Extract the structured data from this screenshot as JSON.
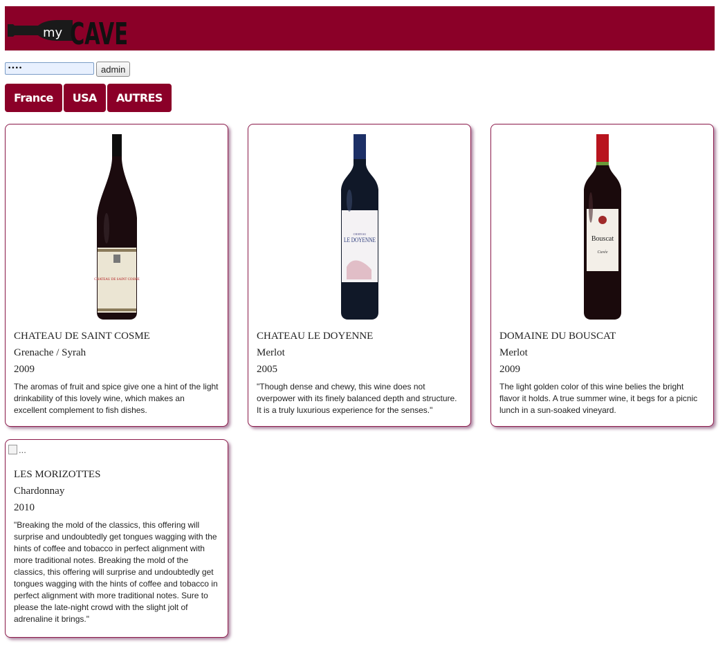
{
  "header": {
    "logo_small": "my",
    "logo_big": "CAVE",
    "brand_color": "#8b0028"
  },
  "login": {
    "password_value": "••••",
    "admin_button": "admin"
  },
  "tabs": [
    "France",
    "USA",
    "AUTRES"
  ],
  "wines": [
    {
      "name": "CHATEAU DE SAINT COSME",
      "grapes": "Grenache / Syrah",
      "year": "2009",
      "description": "The aromas of fruit and spice give one a hint of the light drinkability of this lovely wine, which makes an excellent complement to fish dishes.",
      "label": "CHATEAU DE SAINT COSME"
    },
    {
      "name": "CHATEAU LE DOYENNE",
      "grapes": "Merlot",
      "year": "2005",
      "description": "\"Though dense and chewy, this wine does not overpower with its finely balanced depth and structure. It is a truly luxurious experience for the senses.\"",
      "label": "LE DOYENNE"
    },
    {
      "name": "DOMAINE DU BOUSCAT",
      "grapes": "Merlot",
      "year": "2009",
      "description": "The light golden color of this wine belies the bright flavor it holds. A true summer wine, it begs for a picnic lunch in a sun-soaked vineyard.",
      "label": "Bouscat"
    },
    {
      "name": "LES MORIZOTTES",
      "grapes": "Chardonnay",
      "year": "2010",
      "description": "\"Breaking the mold of the classics, this offering will surprise and undoubtedly get tongues wagging with the hints of coffee and tobacco in perfect alignment with more traditional notes. Breaking the mold of the classics, this offering will surprise and undoubtedly get tongues wagging with the hints of coffee and tobacco in perfect alignment with more traditional notes. Sure to please the late-night crowd with the slight jolt of adrenaline it brings.\"",
      "broken_image_alt": "..."
    }
  ]
}
